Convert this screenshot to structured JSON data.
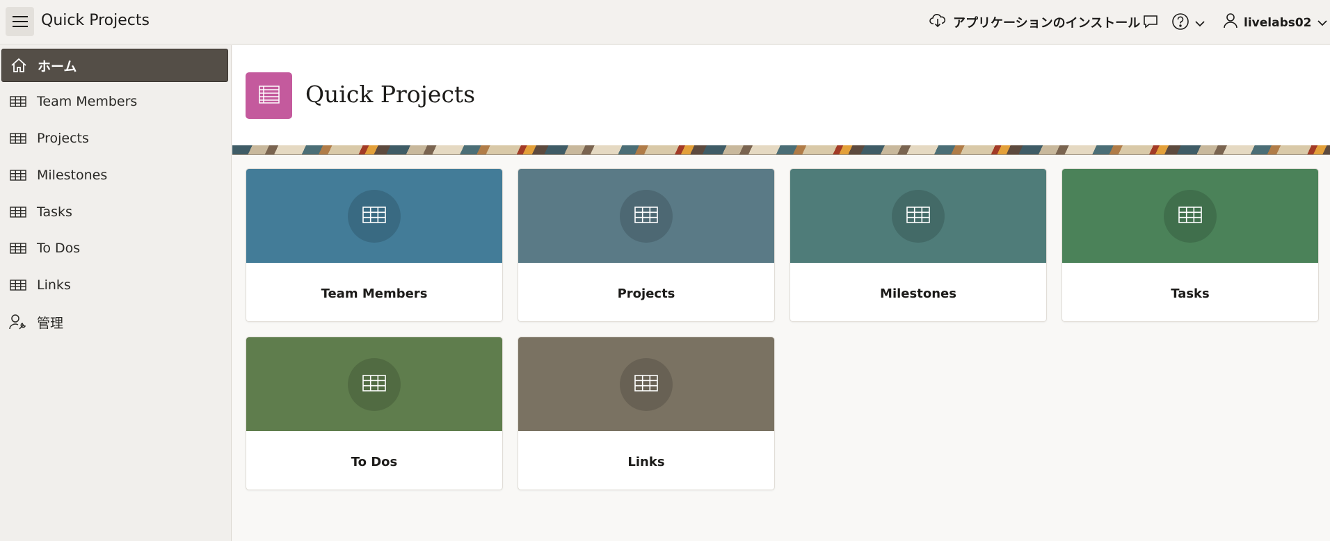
{
  "header": {
    "app_title": "Quick Projects",
    "install_label": "アプリケーションのインストール",
    "username": "livelabs02",
    "icons": [
      "menu-icon",
      "cloud-download-icon",
      "chat-icon",
      "help-icon",
      "chevron-down-icon",
      "user-icon"
    ]
  },
  "sidebar": {
    "items": [
      {
        "label": "ホーム",
        "icon": "home-icon",
        "active": true
      },
      {
        "label": "Team Members",
        "icon": "table-icon"
      },
      {
        "label": "Projects",
        "icon": "table-icon"
      },
      {
        "label": "Milestones",
        "icon": "table-icon"
      },
      {
        "label": "Tasks",
        "icon": "table-icon"
      },
      {
        "label": "To Dos",
        "icon": "table-icon"
      },
      {
        "label": "Links",
        "icon": "table-icon"
      },
      {
        "label": "管理",
        "icon": "user-wrench-icon"
      }
    ]
  },
  "page": {
    "title": "Quick Projects",
    "icon_color": "#c45a9d"
  },
  "cards": [
    {
      "label": "Team Members",
      "color": "#437c98"
    },
    {
      "label": "Projects",
      "color": "#5a7a86"
    },
    {
      "label": "Milestones",
      "color": "#4f7c79"
    },
    {
      "label": "Tasks",
      "color": "#4b8259"
    },
    {
      "label": "To Dos",
      "color": "#5f7d4d"
    },
    {
      "label": "Links",
      "color": "#7a7262"
    }
  ]
}
